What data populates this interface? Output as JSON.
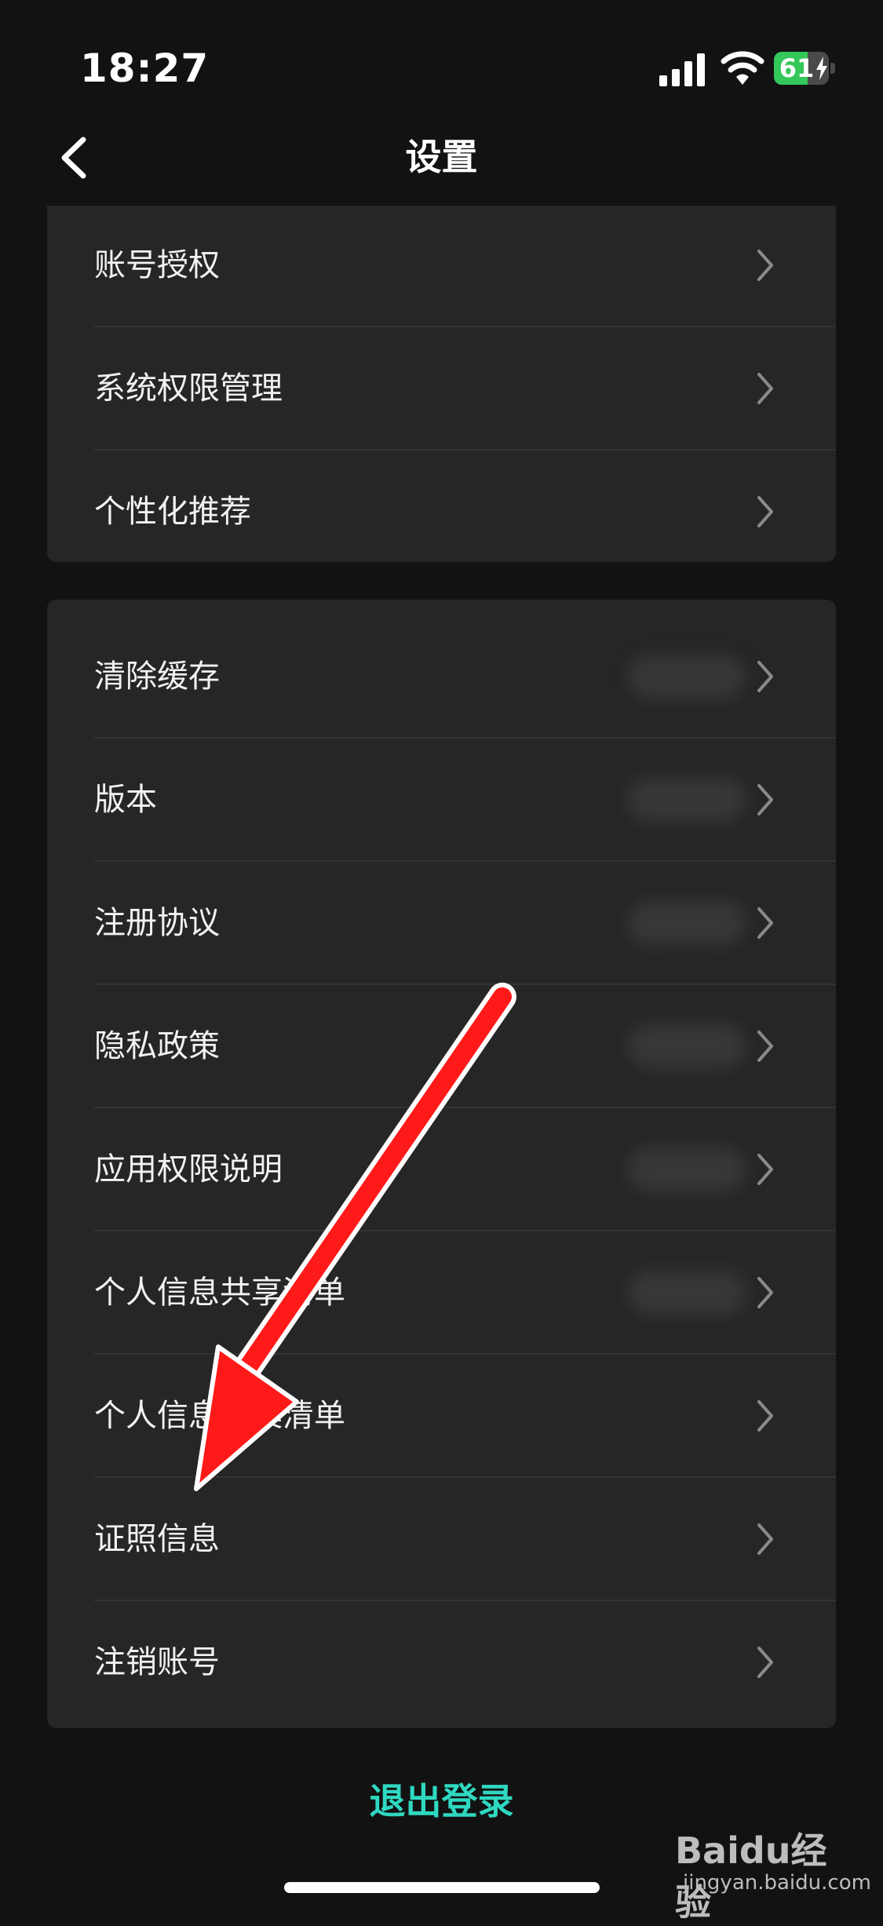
{
  "status": {
    "time": "18:27",
    "battery_percent": "61",
    "battery_level": 0.61,
    "charging": true
  },
  "header": {
    "title": "设置"
  },
  "group1": {
    "items": [
      {
        "label": "账号授权"
      },
      {
        "label": "系统权限管理"
      },
      {
        "label": "个性化推荐"
      }
    ]
  },
  "group2": {
    "items": [
      {
        "label": "清除缓存",
        "has_value": true
      },
      {
        "label": "版本",
        "has_value": true
      },
      {
        "label": "注册协议",
        "has_value": true
      },
      {
        "label": "隐私政策",
        "has_value": true
      },
      {
        "label": "应用权限说明",
        "has_value": true
      },
      {
        "label": "个人信息共享清单",
        "has_value": true
      },
      {
        "label": "个人信息收集清单",
        "has_value": false
      },
      {
        "label": "证照信息",
        "has_value": false
      },
      {
        "label": "注销账号",
        "has_value": false
      }
    ]
  },
  "footer": {
    "logout_label": "退出登录"
  },
  "watermark": {
    "brand": "Baidu经验",
    "url": "jingyan.baidu.com"
  },
  "colors": {
    "accent": "#2fd8c0",
    "arrow": "#ff1a1a",
    "battery": "#34c759"
  },
  "icons": {
    "back": "chevron-left-icon",
    "row": "chevron-right-icon",
    "arrow": "annotation-arrow-icon"
  }
}
